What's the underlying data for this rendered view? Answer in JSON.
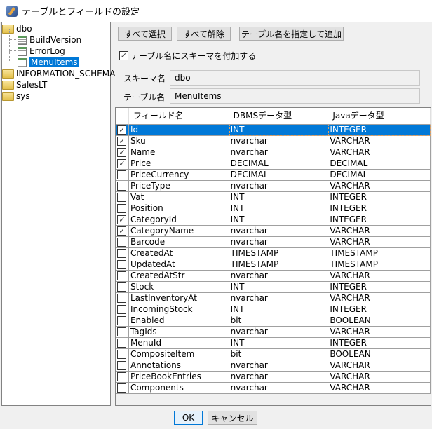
{
  "window": {
    "title": "テーブルとフィールドの設定",
    "icon": "app-icon"
  },
  "tree": {
    "items": [
      {
        "label": "dbo",
        "icon": "folder-icon",
        "level": 0
      },
      {
        "label": "BuildVersion",
        "icon": "table-icon",
        "level": 1
      },
      {
        "label": "ErrorLog",
        "icon": "table-icon",
        "level": 1
      },
      {
        "label": "MenuItems",
        "icon": "table-icon",
        "level": 1,
        "selected": true
      },
      {
        "label": "INFORMATION_SCHEMA",
        "icon": "folder-icon",
        "level": 0
      },
      {
        "label": "SalesLT",
        "icon": "folder-icon",
        "level": 0
      },
      {
        "label": "sys",
        "icon": "folder-icon",
        "level": 0
      }
    ]
  },
  "toolbar": {
    "select_all": "すべて選択",
    "deselect_all": "すべて解除",
    "add_by_name": "テーブル名を指定して追加"
  },
  "schema_prefix": {
    "label": "テーブル名にスキーマを付加する",
    "checked": true
  },
  "schema": {
    "label": "スキーマ名",
    "value": "dbo"
  },
  "table": {
    "label": "テーブル名",
    "value": "MenuItems"
  },
  "grid": {
    "headers": [
      "",
      "フィールド名",
      "DBMSデータ型",
      "Javaデータ型"
    ],
    "rows": [
      {
        "checked": true,
        "name": "Id",
        "dbms": "INT",
        "java": "INTEGER",
        "selected": true
      },
      {
        "checked": true,
        "name": "Sku",
        "dbms": "nvarchar",
        "java": "VARCHAR"
      },
      {
        "checked": true,
        "name": "Name",
        "dbms": "nvarchar",
        "java": "VARCHAR"
      },
      {
        "checked": true,
        "name": "Price",
        "dbms": "DECIMAL",
        "java": "DECIMAL"
      },
      {
        "checked": false,
        "name": "PriceCurrency",
        "dbms": "DECIMAL",
        "java": "DECIMAL"
      },
      {
        "checked": false,
        "name": "PriceType",
        "dbms": "nvarchar",
        "java": "VARCHAR"
      },
      {
        "checked": false,
        "name": "Vat",
        "dbms": "INT",
        "java": "INTEGER"
      },
      {
        "checked": false,
        "name": "Position",
        "dbms": "INT",
        "java": "INTEGER"
      },
      {
        "checked": true,
        "name": "CategoryId",
        "dbms": "INT",
        "java": "INTEGER"
      },
      {
        "checked": true,
        "name": "CategoryName",
        "dbms": "nvarchar",
        "java": "VARCHAR"
      },
      {
        "checked": false,
        "name": "Barcode",
        "dbms": "nvarchar",
        "java": "VARCHAR"
      },
      {
        "checked": false,
        "name": "CreatedAt",
        "dbms": "TIMESTAMP",
        "java": "TIMESTAMP"
      },
      {
        "checked": false,
        "name": "UpdatedAt",
        "dbms": "TIMESTAMP",
        "java": "TIMESTAMP"
      },
      {
        "checked": false,
        "name": "CreatedAtStr",
        "dbms": "nvarchar",
        "java": "VARCHAR"
      },
      {
        "checked": false,
        "name": "Stock",
        "dbms": "INT",
        "java": "INTEGER"
      },
      {
        "checked": false,
        "name": "LastInventoryAt",
        "dbms": "nvarchar",
        "java": "VARCHAR"
      },
      {
        "checked": false,
        "name": "IncomingStock",
        "dbms": "INT",
        "java": "INTEGER"
      },
      {
        "checked": false,
        "name": "Enabled",
        "dbms": "bit",
        "java": "BOOLEAN"
      },
      {
        "checked": false,
        "name": "TagIds",
        "dbms": "nvarchar",
        "java": "VARCHAR"
      },
      {
        "checked": false,
        "name": "MenuId",
        "dbms": "INT",
        "java": "INTEGER"
      },
      {
        "checked": false,
        "name": "CompositeItem",
        "dbms": "bit",
        "java": "BOOLEAN"
      },
      {
        "checked": false,
        "name": "Annotations",
        "dbms": "nvarchar",
        "java": "VARCHAR"
      },
      {
        "checked": false,
        "name": "PriceBookEntries",
        "dbms": "nvarchar",
        "java": "VARCHAR"
      },
      {
        "checked": false,
        "name": "Components",
        "dbms": "nvarchar",
        "java": "VARCHAR"
      }
    ]
  },
  "footer": {
    "ok": "OK",
    "cancel": "キャンセル"
  },
  "colors": {
    "selection": "#0078d7"
  }
}
